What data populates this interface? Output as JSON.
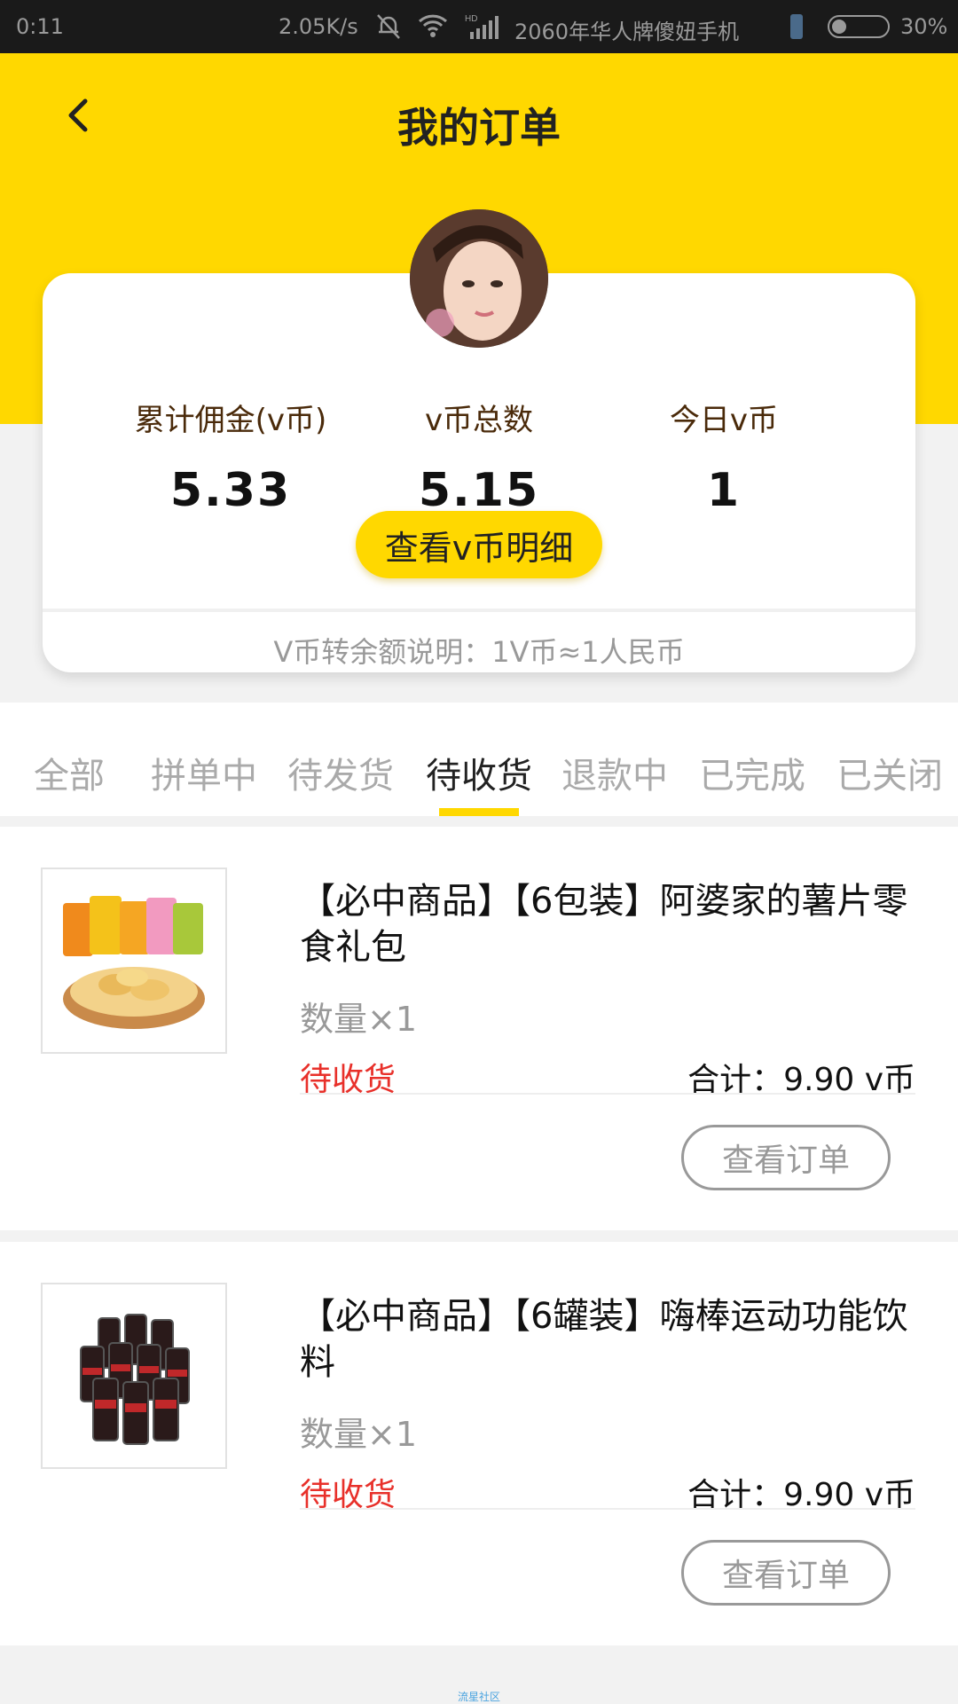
{
  "status_bar": {
    "time": "0:11",
    "speed": "2.05K/s",
    "carrier": "2060年华人牌傻妞手机",
    "battery": "30%",
    "icons": [
      "mute-bell-icon",
      "wifi-icon",
      "hd-signal-icon",
      "phone-icon",
      "battery-icon"
    ]
  },
  "header": {
    "title": "我的订单",
    "back_icon": "back-arrow-icon",
    "accent_color": "#ffd800"
  },
  "summary": {
    "stats": [
      {
        "label": "累计佣金(v币)",
        "value": "5.33"
      },
      {
        "label": "v币总数",
        "value": "5.15"
      },
      {
        "label": "今日v币",
        "value": "1"
      }
    ],
    "detail_button": "查看v币明细",
    "exchange_note": "V币转余额说明：1V币≈1人民币"
  },
  "tabs": [
    {
      "label": "全部",
      "active": false
    },
    {
      "label": "拼单中",
      "active": false
    },
    {
      "label": "待发货",
      "active": false
    },
    {
      "label": "待收货",
      "active": true
    },
    {
      "label": "退款中",
      "active": false
    },
    {
      "label": "已完成",
      "active": false
    },
    {
      "label": "已关闭",
      "active": false
    }
  ],
  "orders": [
    {
      "title": "【必中商品】【6包装】阿婆家的薯片零食礼包",
      "quantity": "数量×1",
      "status": "待收货",
      "total": "合计：9.90 v币",
      "button": "查看订单",
      "image_icon": "potato-chips-icon"
    },
    {
      "title": "【必中商品】【6罐装】嗨棒运动功能饮料",
      "quantity": "数量×1",
      "status": "待收货",
      "total": "合计：9.90 v币",
      "button": "查看订单",
      "image_icon": "energy-drink-cans-icon"
    }
  ],
  "footer": "流星社区",
  "colors": {
    "status_red": "#e8302a",
    "muted": "#999999"
  }
}
